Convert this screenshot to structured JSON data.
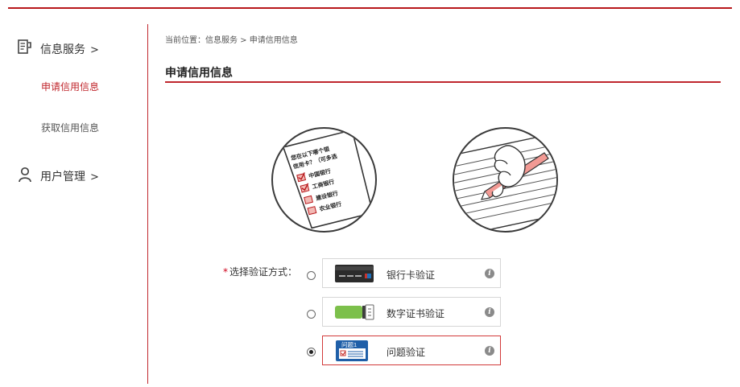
{
  "sidebar": {
    "groups": [
      {
        "label": "信息服务",
        "arrow": ">",
        "icon": "document-icon",
        "items": [
          {
            "label": "申请信用信息",
            "active": true
          },
          {
            "label": "获取信用信息",
            "active": false
          }
        ]
      },
      {
        "label": "用户管理",
        "arrow": ">",
        "icon": "user-icon",
        "items": []
      }
    ]
  },
  "breadcrumb": "当前位置：信息服务 > 申请信用信息",
  "page_title": "申请信用信息",
  "illustrations": {
    "checklist_question": "您在以下哪个银行办理过信用卡？（可多选）",
    "checklist_question_lines": [
      "您在以下哪个银",
      "信用卡？（可多选"
    ],
    "checklist_options": [
      "中国银行",
      "工商银行",
      "建设银行",
      "农业银行"
    ],
    "checklist_checked": [
      true,
      true,
      false,
      false
    ]
  },
  "verify": {
    "required_mark": "*",
    "label": "选择验证方式：",
    "options": [
      {
        "label": "银行卡验证",
        "icon": "bank-card-icon",
        "selected": false
      },
      {
        "label": "数字证书验证",
        "icon": "usb-key-icon",
        "selected": false
      },
      {
        "label": "问题验证",
        "icon": "question-form-icon",
        "icon_text": "问题1",
        "selected": true
      }
    ],
    "info_glyph": "i"
  },
  "colors": {
    "accent": "#c0272d",
    "top_bar": "#b8171b",
    "usb_green": "#7cc04b",
    "form_blue": "#1f5fa8"
  }
}
